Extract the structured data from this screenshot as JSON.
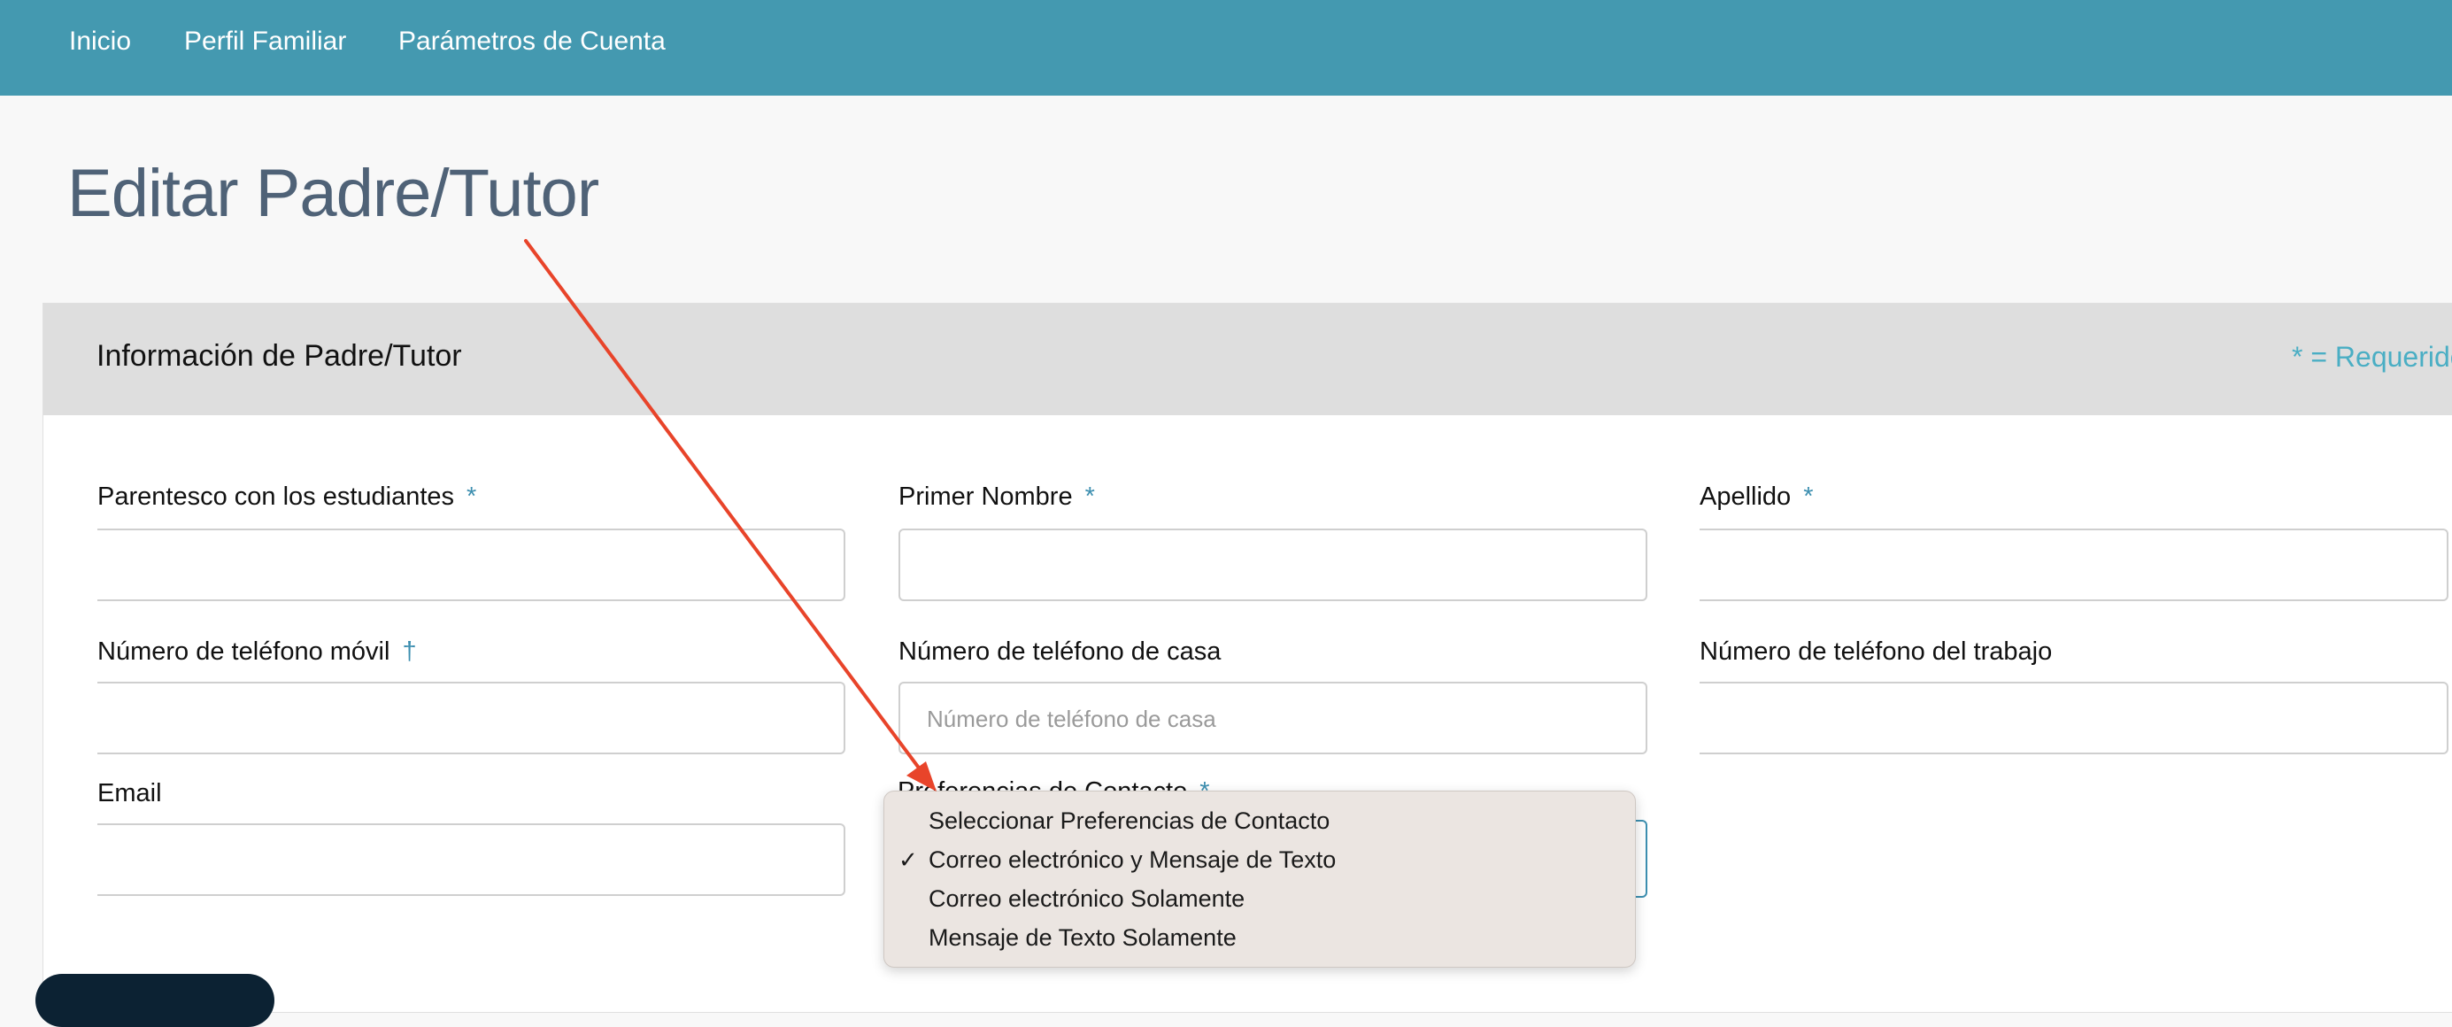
{
  "nav": {
    "items": [
      {
        "label": "Inicio"
      },
      {
        "label": "Perfil Familiar"
      },
      {
        "label": "Parámetros de Cuenta"
      }
    ]
  },
  "page": {
    "title": "Editar Padre/Tutor"
  },
  "card": {
    "title": "Información de Padre/Tutor",
    "required_note": "* = Requerido"
  },
  "form": {
    "relationship_label": "Parentesco con los estudiantes",
    "first_name_label": "Primer Nombre",
    "last_name_label": "Apellido",
    "mobile_label": "Número de teléfono móvil",
    "home_phone_label": "Número de teléfono de casa",
    "home_phone_placeholder": "Número de teléfono de casa",
    "work_phone_label": "Número de teléfono del trabajo",
    "email_label": "Email",
    "contact_pref_label": "Preferencias de Contacto",
    "required_mark": "*",
    "dagger_mark": "†"
  },
  "dropdown": {
    "options": [
      {
        "label": "Seleccionar Preferencias de Contacto",
        "selected": false
      },
      {
        "label": "Correo electrónico y Mensaje de Texto",
        "selected": true
      },
      {
        "label": "Correo electrónico Solamente",
        "selected": false
      },
      {
        "label": "Mensaje de Texto Solamente",
        "selected": false
      }
    ],
    "check_glyph": "✓"
  },
  "colors": {
    "nav_bg": "#4499b0",
    "accent": "#4aaec4",
    "annotation_arrow": "#e8442a"
  }
}
